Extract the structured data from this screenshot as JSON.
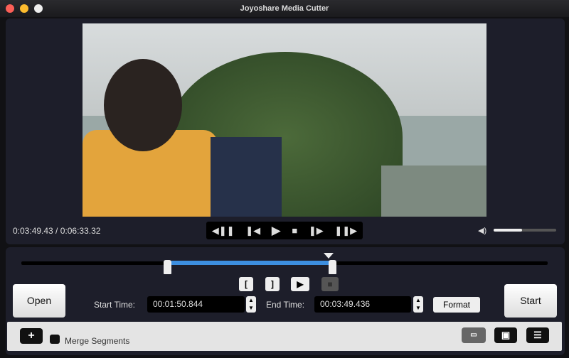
{
  "window": {
    "title": "Joyoshare Media Cutter"
  },
  "player": {
    "time_display": "0:03:49.43 / 0:06:33.32",
    "volume_percent": 45,
    "controls": [
      "previous-segment",
      "previous-frame",
      "play",
      "stop",
      "next-frame",
      "next-segment"
    ]
  },
  "timeline": {
    "selection_start_fraction": 0.28,
    "selection_end_fraction": 0.59,
    "playhead_fraction": 0.59
  },
  "segment_buttons": {
    "mark_in": "[",
    "mark_out": "]"
  },
  "editor": {
    "open_label": "Open",
    "start_time_label": "Start Time:",
    "start_time_value": "00:01:50.844",
    "end_time_label": "End Time:",
    "end_time_value": "00:03:49.436",
    "format_label": "Format",
    "start_label": "Start"
  },
  "bottom": {
    "add_label": "+",
    "merge_label": "Merge Segments"
  },
  "colors": {
    "accent": "#3d8fe0",
    "panel": "#1d1e2a"
  }
}
